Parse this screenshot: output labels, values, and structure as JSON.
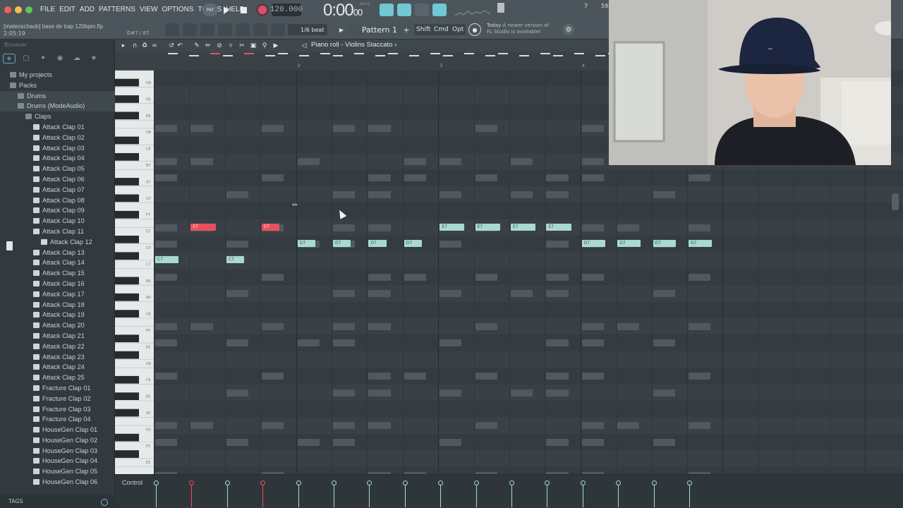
{
  "menu": [
    "FILE",
    "EDIT",
    "ADD",
    "PATTERNS",
    "VIEW",
    "OPTIONS",
    "TOOLS",
    "HELP"
  ],
  "transport": {
    "pattern_song_label": "PAT",
    "tempo": "120.000",
    "time_main": "0:00",
    "time_small": "00",
    "time_format": "M:S:CS"
  },
  "project": {
    "name": "[mateoschaub] base de trap 120bpm.flp",
    "elapsed": "2:05:19",
    "hint": "D#7 / 87"
  },
  "toolbar": {
    "snap": "1/6 beat",
    "pattern": "Pattern 1",
    "mod_shift": "Shift",
    "mod_cmd": "Cmd",
    "mod_opt": "Opt"
  },
  "news": {
    "date": "Today",
    "line1": "A newer version of",
    "line2": "FL Studio is available!"
  },
  "meters": {
    "cpu_num": "7",
    "mem_num": "592"
  },
  "browser": {
    "title": "Browser",
    "tree": [
      {
        "label": "My projects",
        "level": 0,
        "kind": "folder"
      },
      {
        "label": "Packs",
        "level": 0,
        "kind": "folder"
      },
      {
        "label": "Drums",
        "level": 1,
        "kind": "folder",
        "hl": true
      },
      {
        "label": "Drums (ModeAudio)",
        "level": 1,
        "kind": "folder",
        "hl": true
      },
      {
        "label": "Claps",
        "level": 2,
        "kind": "folder"
      },
      {
        "label": "Attack Clap 01",
        "level": 3,
        "kind": "file"
      },
      {
        "label": "Attack Clap 02",
        "level": 3,
        "kind": "file"
      },
      {
        "label": "Attack Clap 03",
        "level": 3,
        "kind": "file"
      },
      {
        "label": "Attack Clap 04",
        "level": 3,
        "kind": "file"
      },
      {
        "label": "Attack Clap 05",
        "level": 3,
        "kind": "file"
      },
      {
        "label": "Attack Clap 06",
        "level": 3,
        "kind": "file"
      },
      {
        "label": "Attack Clap 07",
        "level": 3,
        "kind": "file"
      },
      {
        "label": "Attack Clap 08",
        "level": 3,
        "kind": "file"
      },
      {
        "label": "Attack Clap 09",
        "level": 3,
        "kind": "file"
      },
      {
        "label": "Attack Clap 10",
        "level": 3,
        "kind": "file"
      },
      {
        "label": "Attack Clap 11",
        "level": 3,
        "kind": "file"
      },
      {
        "label": "Attack Clap 12",
        "level": 4,
        "kind": "file"
      },
      {
        "label": "Attack Clap 13",
        "level": 3,
        "kind": "file"
      },
      {
        "label": "Attack Clap 14",
        "level": 3,
        "kind": "file"
      },
      {
        "label": "Attack Clap 15",
        "level": 3,
        "kind": "file"
      },
      {
        "label": "Attack Clap 16",
        "level": 3,
        "kind": "file"
      },
      {
        "label": "Attack Clap 17",
        "level": 3,
        "kind": "file"
      },
      {
        "label": "Attack Clap 18",
        "level": 3,
        "kind": "file"
      },
      {
        "label": "Attack Clap 19",
        "level": 3,
        "kind": "file"
      },
      {
        "label": "Attack Clap 20",
        "level": 3,
        "kind": "file"
      },
      {
        "label": "Attack Clap 21",
        "level": 3,
        "kind": "file"
      },
      {
        "label": "Attack Clap 22",
        "level": 3,
        "kind": "file"
      },
      {
        "label": "Attack Clap 23",
        "level": 3,
        "kind": "file"
      },
      {
        "label": "Attack Clap 24",
        "level": 3,
        "kind": "file"
      },
      {
        "label": "Attack Clap 25",
        "level": 3,
        "kind": "file"
      },
      {
        "label": "Fracture Clap 01",
        "level": 3,
        "kind": "file"
      },
      {
        "label": "Fracture Clap 02",
        "level": 3,
        "kind": "file"
      },
      {
        "label": "Fracture Clap 03",
        "level": 3,
        "kind": "file"
      },
      {
        "label": "Fracture Clap 04",
        "level": 3,
        "kind": "file"
      },
      {
        "label": "HouseGen Clap 01",
        "level": 3,
        "kind": "file"
      },
      {
        "label": "HouseGen Clap 02",
        "level": 3,
        "kind": "file"
      },
      {
        "label": "HouseGen Clap 03",
        "level": 3,
        "kind": "file"
      },
      {
        "label": "HouseGen Clap 04",
        "level": 3,
        "kind": "file"
      },
      {
        "label": "HouseGen Clap 05",
        "level": 3,
        "kind": "file"
      },
      {
        "label": "HouseGen Clap 06",
        "level": 3,
        "kind": "file"
      }
    ],
    "footer": "TAGS"
  },
  "piano_roll": {
    "title": "Piano roll - Violins Staccato",
    "bar_numbers": [
      "2",
      "3",
      "4"
    ],
    "key_labels": [
      "G8",
      "F8",
      "E8",
      "D8",
      "C8",
      "B7",
      "A7",
      "G7",
      "F7",
      "E7",
      "D7",
      "C7",
      "B6",
      "A6",
      "G6",
      "F6",
      "E6",
      "D6",
      "C6",
      "B5",
      "A5",
      "G5",
      "F5",
      "E5",
      "D5",
      "C5",
      "B4",
      "A4"
    ],
    "top_pitch_row_label": "G8",
    "selected_notes": [
      {
        "pitch": "E7",
        "start": 1.0,
        "len": 0.7
      },
      {
        "pitch": "E7",
        "start": 3.0,
        "len": 0.5
      }
    ],
    "active_notes": [
      {
        "pitch": "C7",
        "start": 0.0,
        "len": 0.65
      },
      {
        "pitch": "C7",
        "start": 2.0,
        "len": 0.5
      },
      {
        "pitch": "D7",
        "start": 4.0,
        "len": 0.5
      },
      {
        "pitch": "D7",
        "start": 5.0,
        "len": 0.5
      },
      {
        "pitch": "D7",
        "start": 6.0,
        "len": 0.5
      },
      {
        "pitch": "D7",
        "start": 7.0,
        "len": 0.5
      },
      {
        "pitch": "E7",
        "start": 8.0,
        "len": 0.7
      },
      {
        "pitch": "E7",
        "start": 9.0,
        "len": 0.7
      },
      {
        "pitch": "E7",
        "start": 10.0,
        "len": 0.7
      },
      {
        "pitch": "E7",
        "start": 11.0,
        "len": 0.7
      },
      {
        "pitch": "D7",
        "start": 12.0,
        "len": 0.65
      },
      {
        "pitch": "D7",
        "start": 13.0,
        "len": 0.65
      },
      {
        "pitch": "D7",
        "start": 14.0,
        "len": 0.65
      },
      {
        "pitch": "D7",
        "start": 15.0,
        "len": 0.65
      }
    ]
  },
  "control_lane": {
    "label": "Control",
    "velocities": [
      {
        "step": 0,
        "level": 1.0,
        "selected": false
      },
      {
        "step": 1,
        "level": 1.0,
        "selected": true
      },
      {
        "step": 2,
        "level": 1.0,
        "selected": false
      },
      {
        "step": 3,
        "level": 1.0,
        "selected": true
      },
      {
        "step": 4,
        "level": 1.0,
        "selected": false
      },
      {
        "step": 5,
        "level": 1.0,
        "selected": false
      },
      {
        "step": 6,
        "level": 1.0,
        "selected": false
      },
      {
        "step": 7,
        "level": 1.0,
        "selected": false
      },
      {
        "step": 8,
        "level": 1.0,
        "selected": false
      },
      {
        "step": 9,
        "level": 1.0,
        "selected": false
      },
      {
        "step": 10,
        "level": 1.0,
        "selected": false
      },
      {
        "step": 11,
        "level": 1.0,
        "selected": false
      },
      {
        "step": 12,
        "level": 1.0,
        "selected": false
      },
      {
        "step": 13,
        "level": 1.0,
        "selected": false
      },
      {
        "step": 14,
        "level": 1.0,
        "selected": false
      },
      {
        "step": 15,
        "level": 1.0,
        "selected": false
      }
    ]
  },
  "colors": {
    "selected_note": "#e9505e",
    "active_note": "#a9d9cf",
    "ghost_note": "#4f595e",
    "accent_teal": "#7fd3d9",
    "record_red": "#e0506a"
  }
}
